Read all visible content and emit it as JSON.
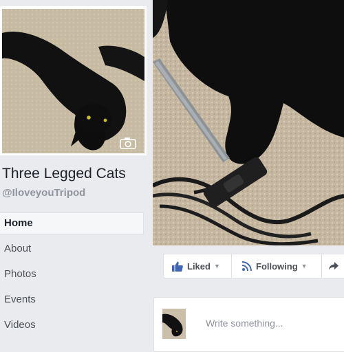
{
  "page": {
    "name": "Three Legged Cats",
    "username": "@IloveyouTripod"
  },
  "nav": {
    "items": [
      {
        "label": "Home",
        "active": true
      },
      {
        "label": "About",
        "active": false
      },
      {
        "label": "Photos",
        "active": false
      },
      {
        "label": "Events",
        "active": false
      },
      {
        "label": "Videos",
        "active": false
      }
    ]
  },
  "actions": {
    "liked_label": "Liked",
    "following_label": "Following",
    "liked_icon": "thumbs-up-icon",
    "following_icon": "rss-icon",
    "share_icon": "share-arrow-icon"
  },
  "composer": {
    "placeholder": "Write something..."
  },
  "colors": {
    "brand_blue": "#4267b2",
    "background": "#e9ebee"
  }
}
